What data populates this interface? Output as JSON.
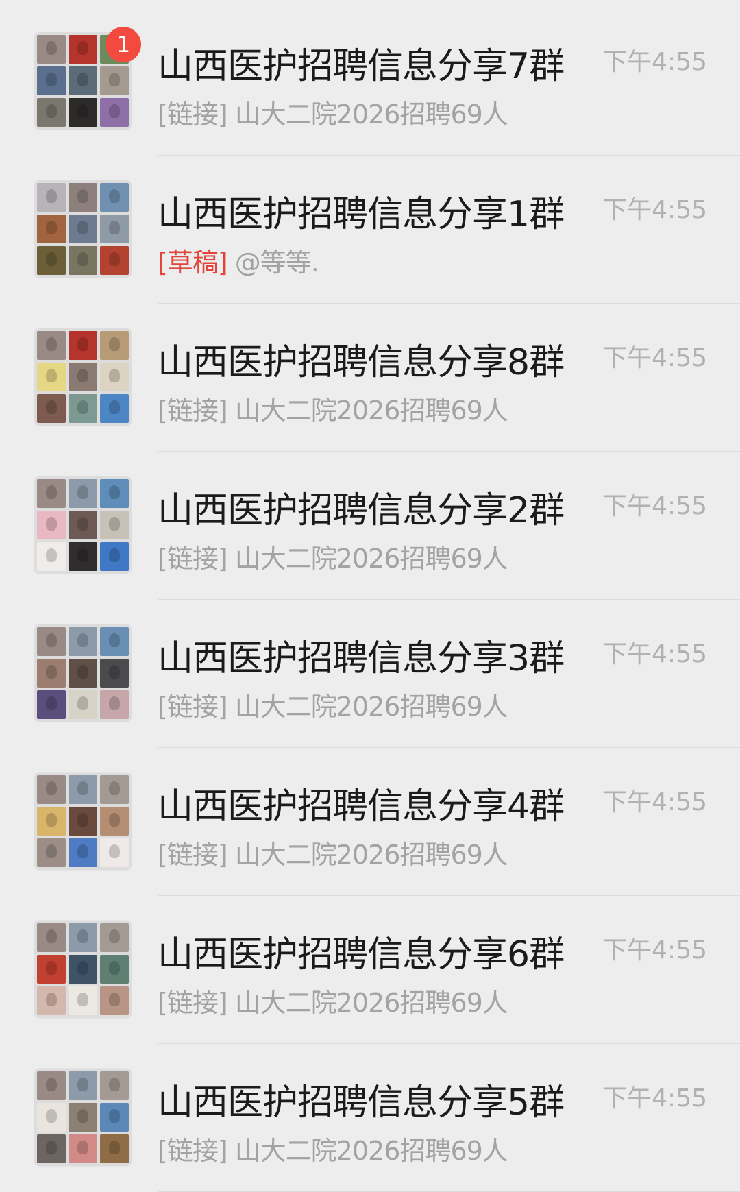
{
  "colors": {
    "background": "#ededed",
    "title_text": "#1b1b1b",
    "preview_text": "#a3a3a3",
    "time_text": "#b1b1b1",
    "draft_text": "#e0443a",
    "badge": "#f24a3f"
  },
  "conversations": [
    {
      "title": "山西医护招聘信息分享7群",
      "preview_tag": "[链接]",
      "preview_text": "山大二院2026招聘69人",
      "time": "下午4:55",
      "unread_badge": "1",
      "avatar_tiles": [
        "#9a8a86",
        "#b5342b",
        "#6c8a5b",
        "#5a6f8e",
        "#5b6b78",
        "#a59a8f",
        "#7a776f",
        "#2d2a2a",
        "#8e6fa8"
      ]
    },
    {
      "title": "山西医护招聘信息分享1群",
      "preview_tag": "[草稿]",
      "preview_text": "@等等.",
      "time": "下午4:55",
      "unread_badge": "",
      "avatar_tiles": [
        "#b7b3b8",
        "#8d807c",
        "#6f90b0",
        "#a2643e",
        "#6d7a8f",
        "#8f9aa7",
        "#6c5e36",
        "#7a7561",
        "#b34231"
      ]
    },
    {
      "title": "山西医护招聘信息分享8群",
      "preview_tag": "[链接]",
      "preview_text": "山大二院2026招聘69人",
      "time": "下午4:55",
      "unread_badge": "",
      "avatar_tiles": [
        "#9a8a86",
        "#b5342b",
        "#b79a76",
        "#e6d784",
        "#8b7a71",
        "#dcd3c2",
        "#7d5b4f",
        "#7c9992",
        "#4d86c4"
      ]
    },
    {
      "title": "山西医护招聘信息分享2群",
      "preview_tag": "[链接]",
      "preview_text": "山大二院2026招聘69人",
      "time": "下午4:55",
      "unread_badge": "",
      "avatar_tiles": [
        "#9a8a86",
        "#8d9aaa",
        "#5d8db8",
        "#e8b9c3",
        "#6d5a55",
        "#c7c1b8",
        "#f0ecea",
        "#2f2d2e",
        "#3f78c4"
      ]
    },
    {
      "title": "山西医护招聘信息分享3群",
      "preview_tag": "[链接]",
      "preview_text": "山大二院2026招聘69人",
      "time": "下午4:55",
      "unread_badge": "",
      "avatar_tiles": [
        "#9a8a86",
        "#8d9aaa",
        "#6a8fb5",
        "#9c7d70",
        "#5f5047",
        "#4b4a4c",
        "#5a4f7c",
        "#d7d3c7",
        "#c6a6a8"
      ]
    },
    {
      "title": "山西医护招聘信息分享4群",
      "preview_tag": "[链接]",
      "preview_text": "山大二院2026招聘69人",
      "time": "下午4:55",
      "unread_badge": "",
      "avatar_tiles": [
        "#9a8a86",
        "#8d9aaa",
        "#a49a94",
        "#d9b56a",
        "#6a4a3c",
        "#b48d72",
        "#9c8d86",
        "#4e7bc2",
        "#efeae7"
      ]
    },
    {
      "title": "山西医护招聘信息分享6群",
      "preview_tag": "[链接]",
      "preview_text": "山大二院2026招聘69人",
      "time": "下午4:55",
      "unread_badge": "",
      "avatar_tiles": [
        "#9a8a86",
        "#8d9aaa",
        "#a49a94",
        "#c2402f",
        "#3f5367",
        "#5f7f73",
        "#d5b8ad",
        "#ece8e2",
        "#b89584"
      ]
    },
    {
      "title": "山西医护招聘信息分享5群",
      "preview_tag": "[链接]",
      "preview_text": "山大二院2026招聘69人",
      "time": "下午4:55",
      "unread_badge": "",
      "avatar_tiles": [
        "#9a8a86",
        "#8d9aaa",
        "#a49a94",
        "#e9e4de",
        "#8c7f73",
        "#5b88b7",
        "#6d6562",
        "#d28a86",
        "#8e6c45"
      ]
    }
  ]
}
